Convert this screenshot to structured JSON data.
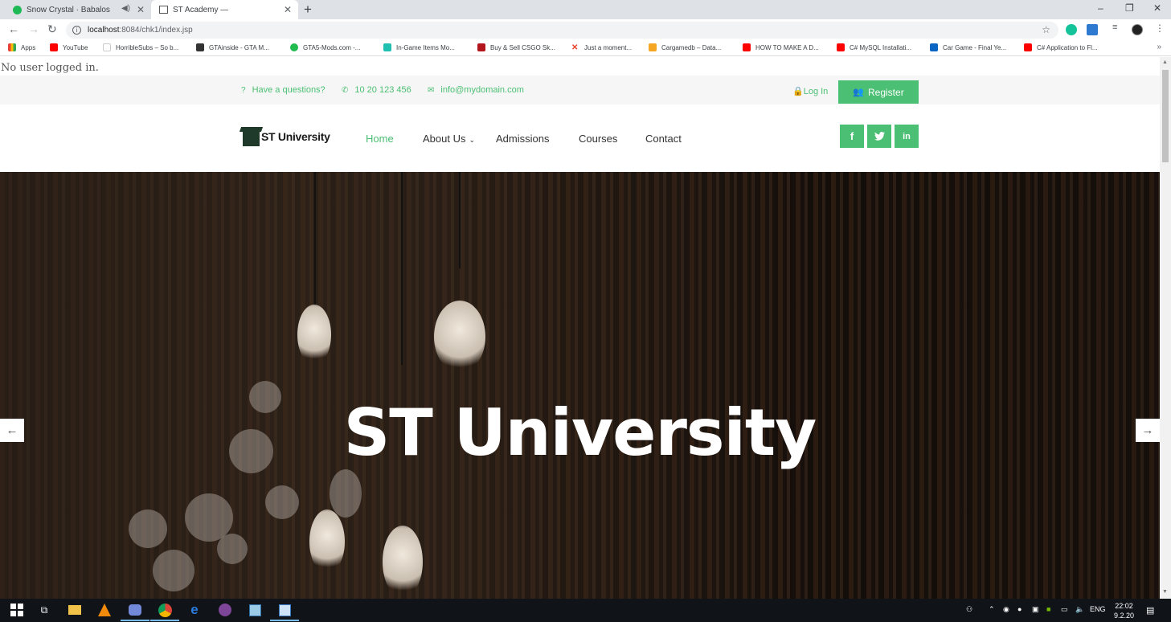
{
  "browser": {
    "tabs": [
      {
        "title": "Snow Crystal · Babalos",
        "icon": "spotify-icon",
        "active": false,
        "audio": true
      },
      {
        "title": "ST Academy —",
        "icon": "site-favicon",
        "active": true,
        "audio": false
      }
    ],
    "new_tab": "+",
    "window_controls": [
      "–",
      "❐",
      "✕"
    ],
    "url_host": "localhost",
    "url_path": ":8084/chk1/index.jsp",
    "bookmarks": [
      {
        "label": "Apps",
        "icon": "apps-grid-icon"
      },
      {
        "label": "YouTube",
        "icon": "youtube-icon"
      },
      {
        "label": "HorribleSubs – So b...",
        "icon": "horriblesubs-icon"
      },
      {
        "label": "GTAinside - GTA M...",
        "icon": "gtainside-icon"
      },
      {
        "label": "GTA5-Mods.com -...",
        "icon": "gta5mods-icon"
      },
      {
        "label": "In-Game Items Mo...",
        "icon": "ingame-items-icon"
      },
      {
        "label": "Buy & Sell CSGO Sk...",
        "icon": "csgo-icon"
      },
      {
        "label": "Just a moment...",
        "icon": "x-icon"
      },
      {
        "label": "Cargamedb – Data...",
        "icon": "cargamedb-icon"
      },
      {
        "label": "HOW TO MAKE A D...",
        "icon": "youtube-icon"
      },
      {
        "label": "C# MySQL Installati...",
        "icon": "youtube-icon"
      },
      {
        "label": "Car Game - Final Ye...",
        "icon": "linkedin-icon"
      },
      {
        "label": "C# Application to Fl...",
        "icon": "youtube-icon"
      }
    ],
    "bookmarks_more": "»"
  },
  "page": {
    "login_status": "No user logged in.",
    "topbar": {
      "question": "Have a questions?",
      "phone": "10 20 123 456",
      "email": "info@mydomain.com",
      "login": "Log In",
      "register": "Register"
    },
    "logo_text": "ST University",
    "menu": [
      {
        "label": "Home",
        "active": true
      },
      {
        "label": "About Us",
        "active": false,
        "dropdown": true
      },
      {
        "label": "Admissions",
        "active": false
      },
      {
        "label": "Courses",
        "active": false
      },
      {
        "label": "Contact",
        "active": false
      }
    ],
    "social": [
      "f",
      "t",
      "in"
    ],
    "hero_title": "ST University",
    "prev_arrow": "←",
    "next_arrow": "→",
    "accent_color": "#4bbf73"
  },
  "taskbar": {
    "apps": [
      "start-icon",
      "task-view-icon",
      "file-explorer-icon",
      "vlc-icon",
      "discord-icon",
      "chrome-icon",
      "edge-icon",
      "tor-icon",
      "virtualbox-icon",
      "notepad-icon"
    ],
    "tray_language": "ENG",
    "time": "22:02",
    "date": "9.2.20"
  }
}
